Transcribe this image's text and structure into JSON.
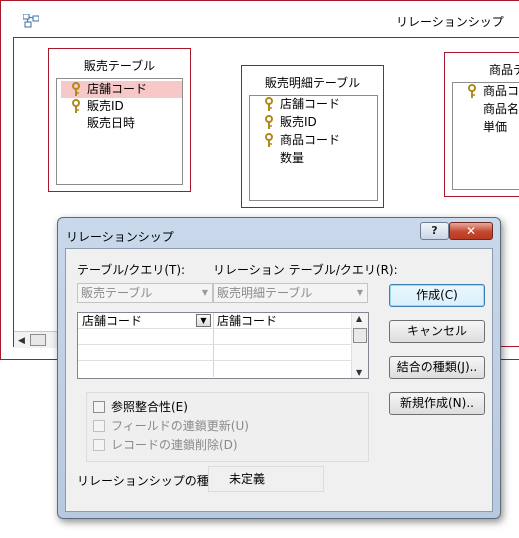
{
  "relationships_window": {
    "title": "リレーションシップ",
    "tables": [
      {
        "title": "販売テーブル",
        "fields": [
          {
            "name": "店舗コード",
            "key": true,
            "selected": true
          },
          {
            "name": "販売ID",
            "key": true
          },
          {
            "name": "販売日時",
            "key": false
          }
        ]
      },
      {
        "title": "販売明細テーブル",
        "fields": [
          {
            "name": "店舗コード",
            "key": true
          },
          {
            "name": "販売ID",
            "key": true
          },
          {
            "name": "商品コード",
            "key": true
          },
          {
            "name": "数量",
            "key": false
          }
        ]
      },
      {
        "title": "商品テ",
        "fields": [
          {
            "name": "商品コー",
            "key": true
          },
          {
            "name": "商品名",
            "key": false
          },
          {
            "name": "単価",
            "key": false
          }
        ]
      }
    ]
  },
  "dialog": {
    "title": "リレーションシップ",
    "help_label": "?",
    "close_label": "✕",
    "table_query_label": "テーブル/クエリ(T):",
    "related_table_query_label": "リレーション テーブル/クエリ(R):",
    "table_query_value": "販売テーブル",
    "related_table_query_value": "販売明細テーブル",
    "grid": {
      "rows": [
        {
          "left": "店舗コード",
          "right": "店舗コード"
        },
        {
          "left": "",
          "right": ""
        },
        {
          "left": "",
          "right": ""
        },
        {
          "left": "",
          "right": ""
        }
      ]
    },
    "buttons": {
      "create": "作成(C)",
      "cancel": "キャンセル",
      "join_type": "結合の種類(J)..",
      "create_new": "新規作成(N).."
    },
    "checks": {
      "integrity": "参照整合性(E)",
      "cascade_update": "フィールドの連鎖更新(U)",
      "cascade_delete": "レコードの連鎖削除(D)"
    },
    "relationship_type_label": "リレーションシップの種類",
    "relationship_type_value": "未定義"
  }
}
